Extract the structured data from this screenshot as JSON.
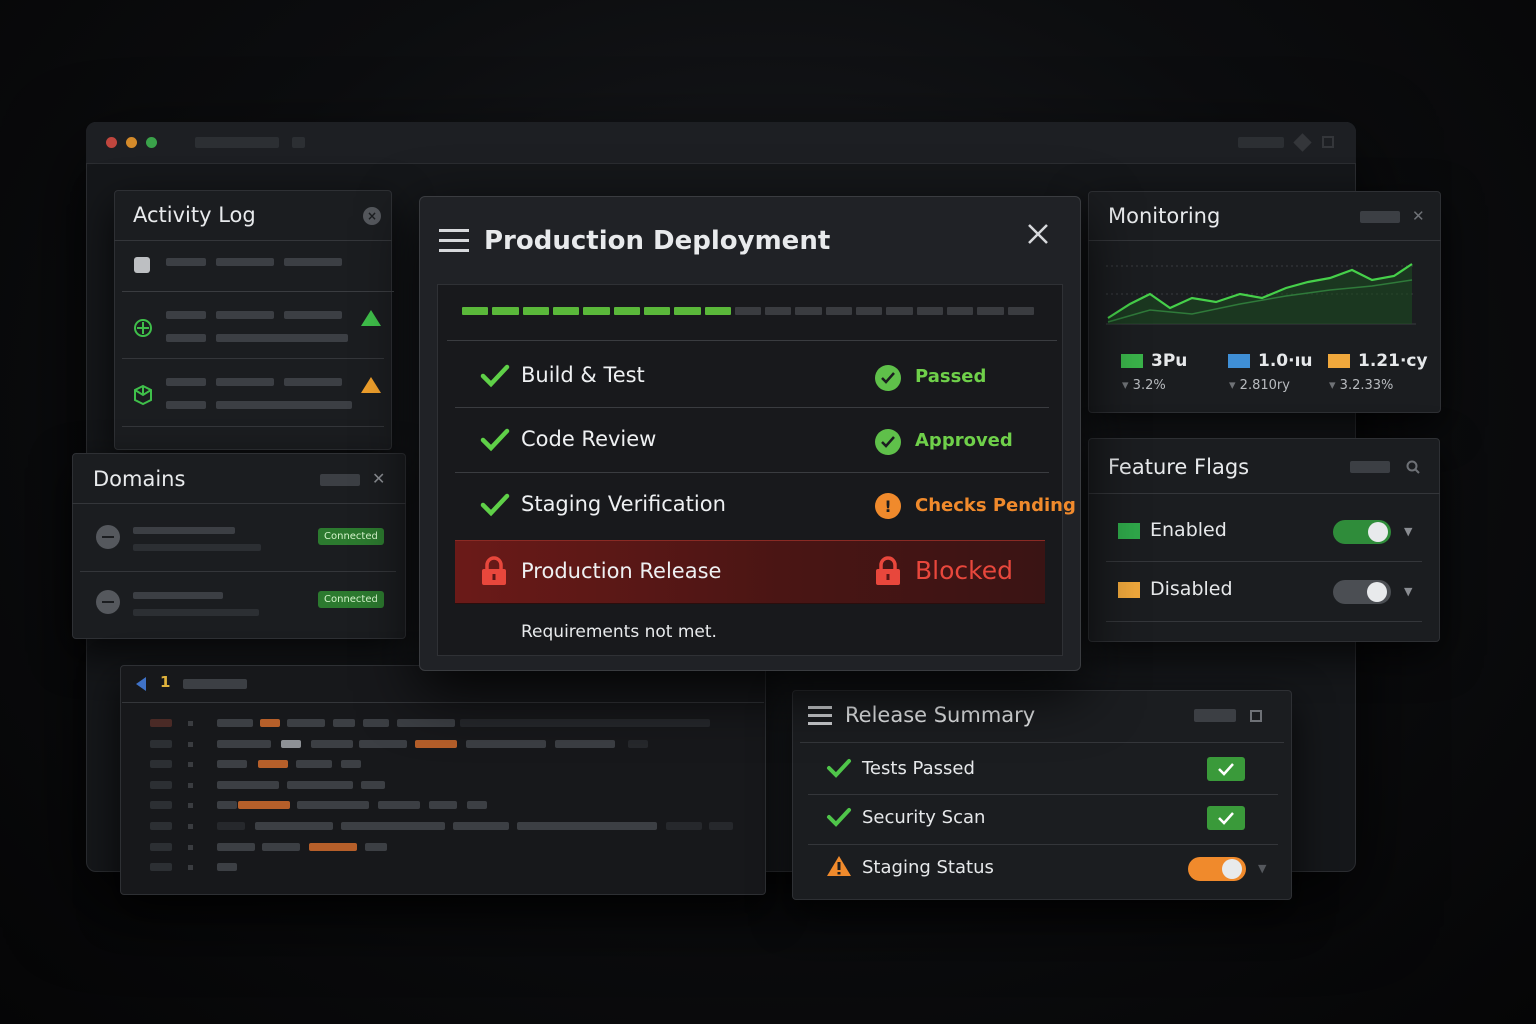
{
  "colors": {
    "green": "#5fd048",
    "orange": "#f08a2c",
    "red": "#e8473c",
    "blue": "#3f8fd6",
    "yellow": "#f0a83c"
  },
  "activity_log": {
    "title": "Activity Log"
  },
  "domains": {
    "title": "Domains",
    "rows": [
      {
        "status": "Connected"
      },
      {
        "status": "Connected"
      }
    ]
  },
  "deployment": {
    "title": "Production Deployment",
    "progress": 0.45,
    "steps": [
      {
        "label": "Build & Test",
        "status": "Passed",
        "state": "ok"
      },
      {
        "label": "Code Review",
        "status": "Approved",
        "state": "ok"
      },
      {
        "label": "Staging Verification",
        "status": "Checks Pending",
        "state": "pending"
      },
      {
        "label": "Production Release",
        "status": "Blocked",
        "state": "blocked"
      }
    ],
    "message": "Requirements not met."
  },
  "monitoring": {
    "title": "Monitoring",
    "metrics": [
      {
        "value": "3Pu",
        "sub": "3.2%",
        "color": "#3ab34a"
      },
      {
        "value": "1.0·ıu",
        "sub": "2.810ry",
        "color": "#3f8fd6"
      },
      {
        "value": "1.21·cy",
        "sub": "3.2.33%",
        "color": "#f0a83c"
      }
    ]
  },
  "feature_flags": {
    "title": "Feature Flags",
    "items": [
      {
        "label": "Enabled",
        "color": "#2fa84a",
        "on": true
      },
      {
        "label": "Disabled",
        "color": "#f0a83c",
        "on": false
      }
    ]
  },
  "editor": {
    "line_number": "1"
  },
  "release_summary": {
    "title": "Release Summary",
    "items": [
      {
        "label": "Tests Passed",
        "state": "check"
      },
      {
        "label": "Security Scan",
        "state": "check"
      },
      {
        "label": "Staging Status",
        "state": "warning-toggle"
      }
    ]
  }
}
